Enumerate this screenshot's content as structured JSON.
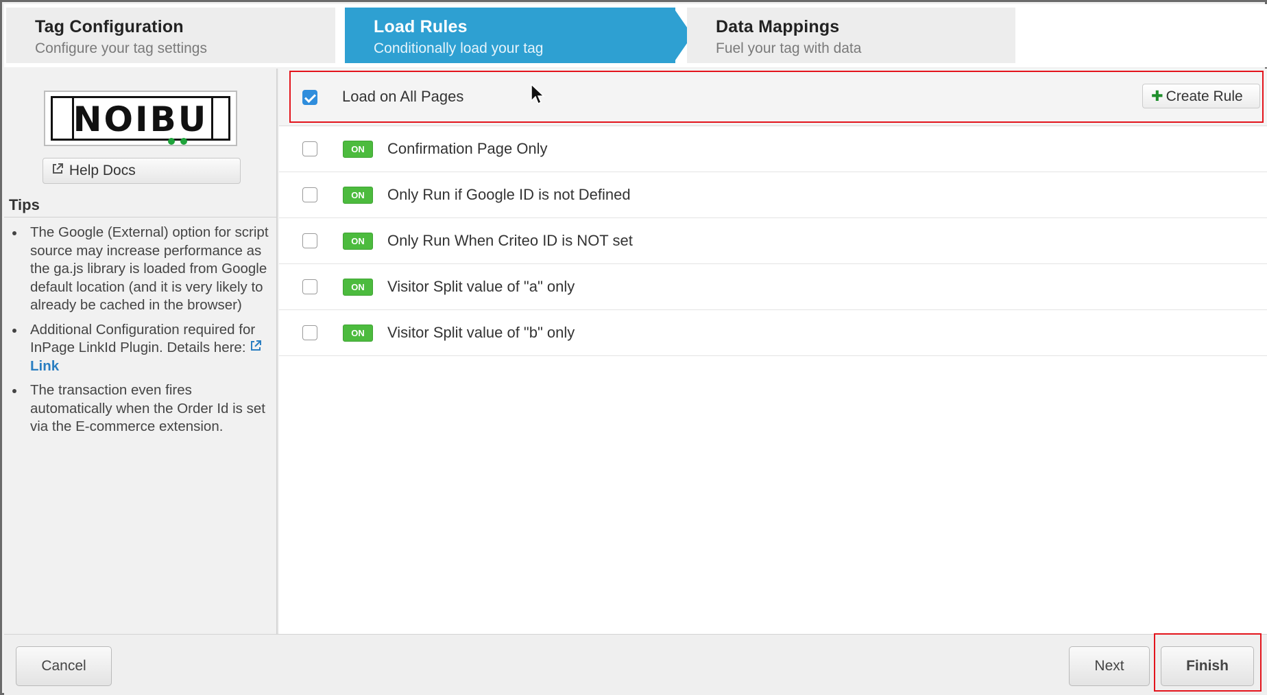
{
  "steps": [
    {
      "title": "Tag Configuration",
      "subtitle": "Configure your tag settings",
      "active": false
    },
    {
      "title": "Load Rules",
      "subtitle": "Conditionally load your tag",
      "active": true
    },
    {
      "title": "Data Mappings",
      "subtitle": "Fuel your tag with data",
      "active": false
    }
  ],
  "sidebar": {
    "logo_text": "NOIBU",
    "help_docs_label": "Help Docs",
    "tips_title": "Tips",
    "tips": [
      "The Google (External) option for script source may increase performance as the ga.js library is loaded from Google default location (and it is very likely to already be cached in the browser)",
      "Additional Configuration required for InPage LinkId Plugin. Details here:",
      "The transaction even fires automatically when the Order Id is set via the E-commerce extension."
    ],
    "tip_link_label": "Link"
  },
  "rules": {
    "all_pages": {
      "label": "Load on All Pages",
      "checked": true
    },
    "create_rule_label": "Create Rule",
    "badge_label": "ON",
    "items": [
      {
        "label": "Confirmation Page Only",
        "checked": false,
        "status": "ON"
      },
      {
        "label": "Only Run if Google ID is not Defined",
        "checked": false,
        "status": "ON"
      },
      {
        "label": "Only Run When Criteo ID is NOT set",
        "checked": false,
        "status": "ON"
      },
      {
        "label": "Visitor Split value of \"a\" only",
        "checked": false,
        "status": "ON"
      },
      {
        "label": "Visitor Split value of \"b\" only",
        "checked": false,
        "status": "ON"
      }
    ]
  },
  "footer": {
    "cancel_label": "Cancel",
    "next_label": "Next",
    "finish_label": "Finish"
  },
  "colors": {
    "active_step": "#2ea0d2",
    "on_badge": "#4cbb3e",
    "checkbox_checked": "#2f8ddc",
    "highlight": "#e3131b",
    "link": "#2a7ec1"
  }
}
